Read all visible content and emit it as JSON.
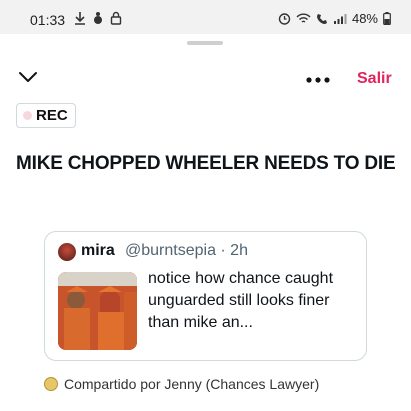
{
  "status_bar": {
    "time": "01:33",
    "battery": "48%"
  },
  "header": {
    "exit_label": "Salir"
  },
  "rec_badge": {
    "label": "REC"
  },
  "post": {
    "headline": "MIKE CHOPPED WHEELER NEEDS TO DIE"
  },
  "quoted_post": {
    "author_name": "mira",
    "author_meta": "@burntsepia · 2h",
    "text": "notice how chance caught unguarded still looks finer than mike an..."
  },
  "shared_by": {
    "text": "Compartido por Jenny (Chances Lawyer)"
  },
  "colors": {
    "accent": "#e0245e",
    "border": "#cfd9de",
    "muted_text": "#536471"
  }
}
